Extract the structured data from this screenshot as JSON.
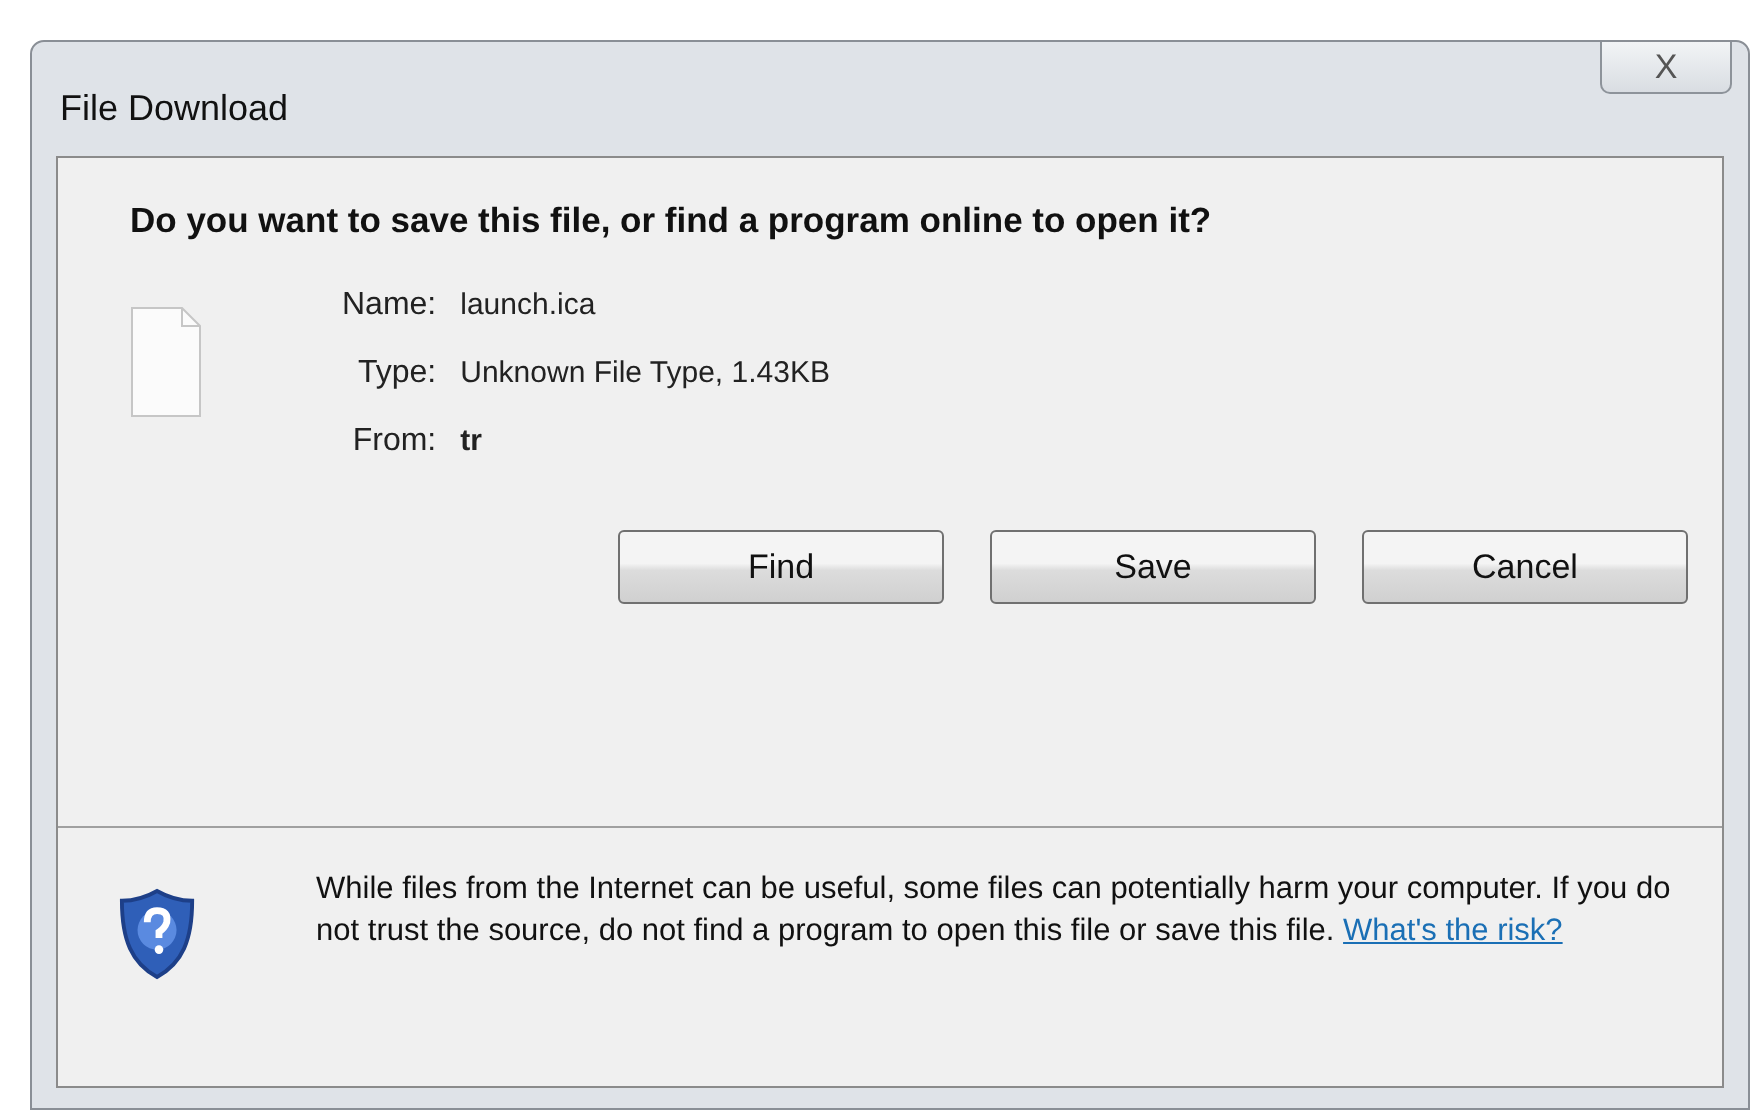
{
  "window": {
    "title": "File Download",
    "close": "X"
  },
  "question": "Do you want to save this file, or find a program online to open it?",
  "details": [
    {
      "label": "Name:",
      "value": "launch.ica",
      "bold": false
    },
    {
      "label": "Type:",
      "value": "Unknown File Type, 1.43KB",
      "bold": false
    },
    {
      "label": "From:",
      "value": "tr",
      "bold": true
    }
  ],
  "buttons": [
    "Find",
    "Save",
    "Cancel"
  ],
  "warning": {
    "text": "While files from the Internet can be useful, some files can potentially harm your computer. If you do not trust the source, do not find a program to open this file or save this file.",
    "link": "What's the risk?"
  }
}
